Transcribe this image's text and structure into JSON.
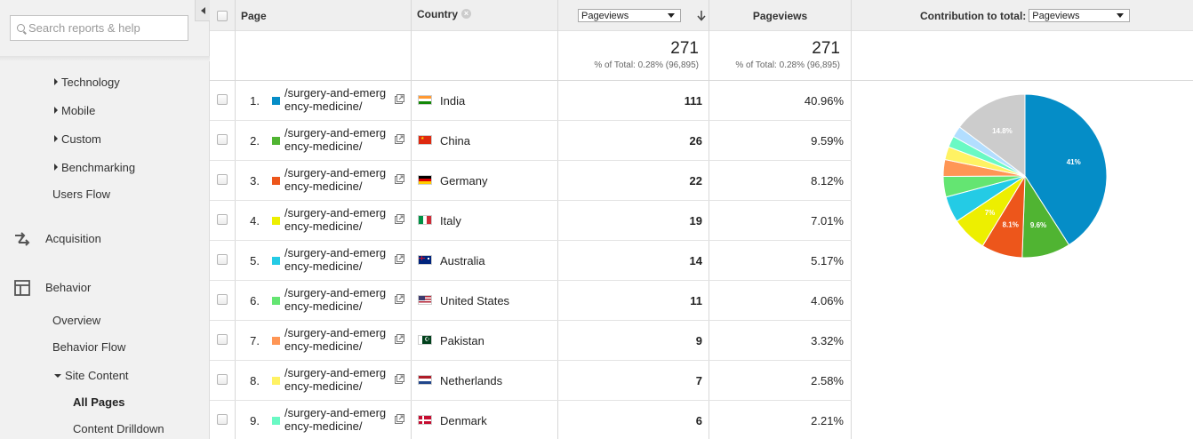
{
  "sidebar": {
    "search_placeholder": "Search reports & help",
    "items": [
      {
        "label": "Technology"
      },
      {
        "label": "Mobile"
      },
      {
        "label": "Custom"
      },
      {
        "label": "Benchmarking"
      },
      {
        "label": "Users Flow"
      },
      {
        "label": "Acquisition"
      },
      {
        "label": "Behavior"
      },
      {
        "label": "Overview"
      },
      {
        "label": "Behavior Flow"
      },
      {
        "label": "Site Content"
      },
      {
        "label": "All Pages"
      },
      {
        "label": "Content Drilldown"
      }
    ]
  },
  "table": {
    "headers": {
      "page": "Page",
      "country": "Country",
      "metric_select": "Pageviews",
      "pageviews": "Pageviews",
      "contribution": "Contribution to total:",
      "contribution_select": "Pageviews"
    },
    "totals": {
      "value1": "271",
      "sub1": "% of Total: 0.28% (96,895)",
      "value2": "271",
      "sub2": "% of Total: 0.28% (96,895)"
    },
    "rows": [
      {
        "num": "1.",
        "page": "/surgery-and-emergency-medicine/",
        "country": "India",
        "pageviews": "111",
        "pct": "40.96%",
        "color": "#058dc7",
        "flag": "india"
      },
      {
        "num": "2.",
        "page": "/surgery-and-emergency-medicine/",
        "country": "China",
        "pageviews": "26",
        "pct": "9.59%",
        "color": "#50b432",
        "flag": "china"
      },
      {
        "num": "3.",
        "page": "/surgery-and-emergency-medicine/",
        "country": "Germany",
        "pageviews": "22",
        "pct": "8.12%",
        "color": "#ed561b",
        "flag": "germany"
      },
      {
        "num": "4.",
        "page": "/surgery-and-emergency-medicine/",
        "country": "Italy",
        "pageviews": "19",
        "pct": "7.01%",
        "color": "#edef00",
        "flag": "italy"
      },
      {
        "num": "5.",
        "page": "/surgery-and-emergency-medicine/",
        "country": "Australia",
        "pageviews": "14",
        "pct": "5.17%",
        "color": "#24cbe5",
        "flag": "australia"
      },
      {
        "num": "6.",
        "page": "/surgery-and-emergency-medicine/",
        "country": "United States",
        "pageviews": "11",
        "pct": "4.06%",
        "color": "#64e572",
        "flag": "usa"
      },
      {
        "num": "7.",
        "page": "/surgery-and-emergency-medicine/",
        "country": "Pakistan",
        "pageviews": "9",
        "pct": "3.32%",
        "color": "#ff9655",
        "flag": "pakistan"
      },
      {
        "num": "8.",
        "page": "/surgery-and-emergency-medicine/",
        "country": "Netherlands",
        "pageviews": "7",
        "pct": "2.58%",
        "color": "#fff263",
        "flag": "netherlands"
      },
      {
        "num": "9.",
        "page": "/surgery-and-emergency-medicine/",
        "country": "Denmark",
        "pageviews": "6",
        "pct": "2.21%",
        "color": "#6af9c4",
        "flag": "denmark"
      }
    ]
  },
  "chart_data": {
    "type": "pie",
    "labels": [
      "India",
      "China",
      "Germany",
      "Italy",
      "Australia",
      "United States",
      "Pakistan",
      "Netherlands",
      "Denmark",
      "",
      ""
    ],
    "values": [
      40.96,
      9.59,
      8.12,
      7.01,
      5.17,
      4.06,
      3.32,
      2.58,
      2.21,
      2.2,
      14.78
    ],
    "colors": [
      "#058dc7",
      "#50b432",
      "#ed561b",
      "#edef00",
      "#24cbe5",
      "#64e572",
      "#ff9655",
      "#fff263",
      "#6af9c4",
      "#b2deff",
      "#cccccc"
    ],
    "slice_labels": [
      "41%",
      "9.6%",
      "8.1%",
      "7%",
      "",
      "",
      "",
      "",
      "",
      "",
      "14.8%"
    ]
  }
}
